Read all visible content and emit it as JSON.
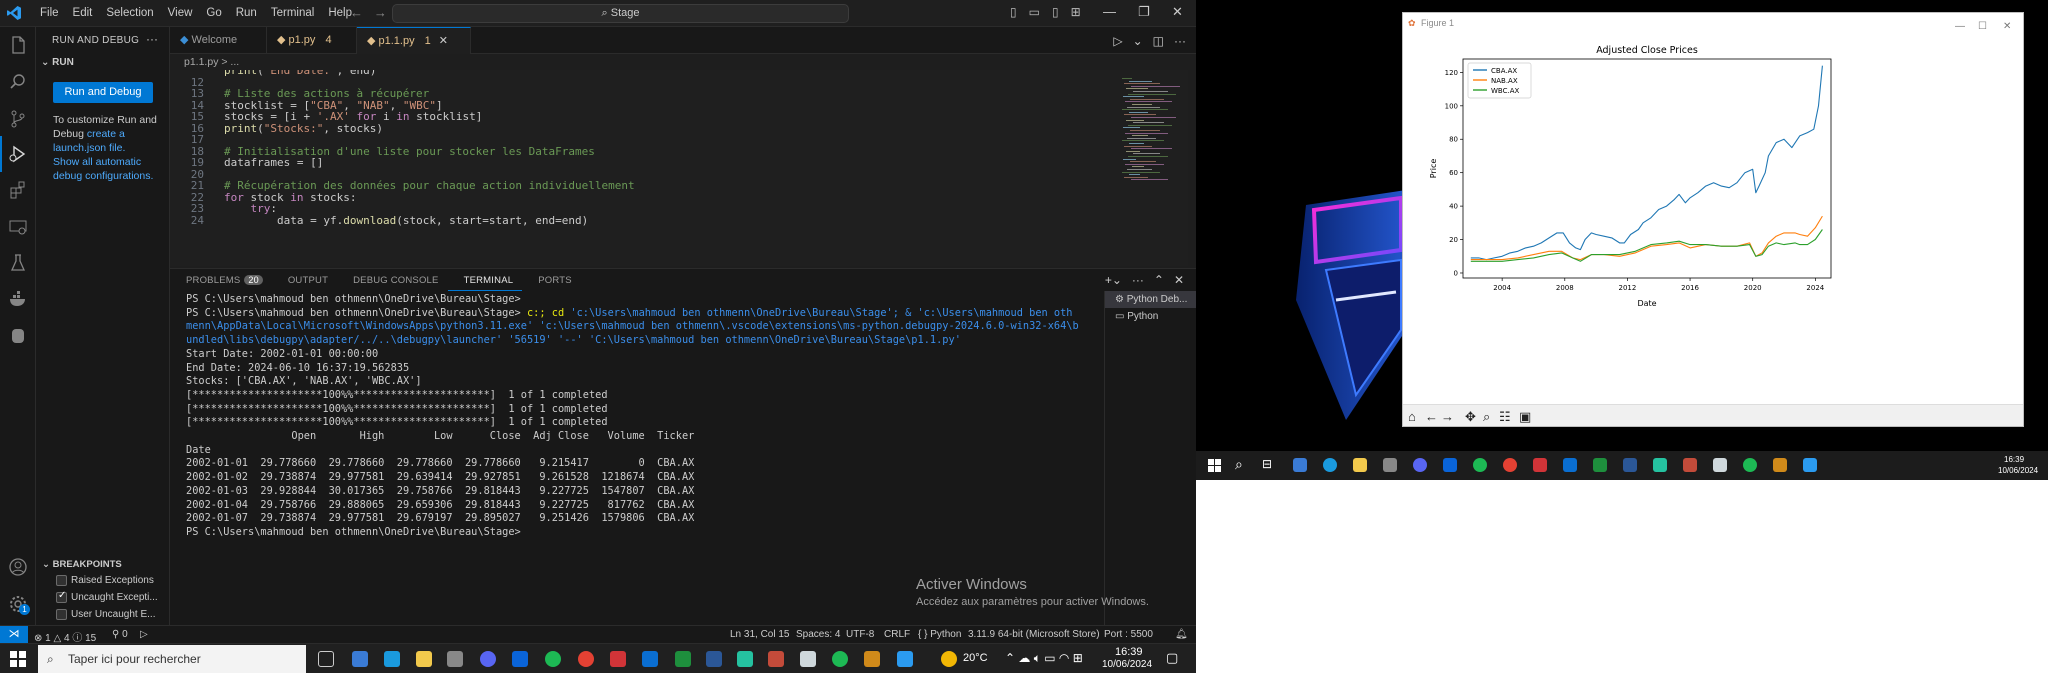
{
  "vscode": {
    "menu": [
      "File",
      "Edit",
      "Selection",
      "View",
      "Go",
      "Run",
      "Terminal",
      "Help"
    ],
    "command_center": "Stage",
    "activity_icons": [
      "explorer-icon",
      "search-icon",
      "source-control-icon",
      "run-debug-icon",
      "extensions-icon",
      "remote-explorer-icon",
      "testing-icon",
      "docker-icon",
      "toolbox-icon",
      "account-icon",
      "settings-gear-icon"
    ],
    "settings_badge": "1",
    "sidebar": {
      "header": "RUN AND DEBUG",
      "section": "RUN",
      "run_button": "Run and Debug",
      "customize_text_1": "To customize Run and Debug ",
      "customize_link": "create a launch.json file.",
      "show_all_link": "Show all automatic debug configurations.",
      "breakpoints_header": "BREAKPOINTS",
      "breakpoints": [
        {
          "label": "Raised Exceptions",
          "checked": false
        },
        {
          "label": "Uncaught Excepti...",
          "checked": true
        },
        {
          "label": "User Uncaught E...",
          "checked": false
        }
      ]
    },
    "tabs": [
      {
        "label": "Welcome",
        "badge": ""
      },
      {
        "label": "p1.py",
        "badge": "4"
      },
      {
        "label": "p1.1.py",
        "badge": "1"
      }
    ],
    "breadcrumb": "p1.1.py > ...",
    "code_lines": [
      {
        "n": "",
        "text": "print(\"End Date:\", end)"
      },
      {
        "n": "12",
        "text": ""
      },
      {
        "n": "13",
        "text": "# Liste des actions à récupérer"
      },
      {
        "n": "14",
        "text": "stocklist = [\"CBA\", \"NAB\", \"WBC\"]"
      },
      {
        "n": "15",
        "text": "stocks = [i + '.AX' for i in stocklist]"
      },
      {
        "n": "16",
        "text": "print(\"Stocks:\", stocks)"
      },
      {
        "n": "17",
        "text": ""
      },
      {
        "n": "18",
        "text": "# Initialisation d'une liste pour stocker les DataFrames"
      },
      {
        "n": "19",
        "text": "dataframes = []"
      },
      {
        "n": "20",
        "text": ""
      },
      {
        "n": "21",
        "text": "# Récupération des données pour chaque action individuellement"
      },
      {
        "n": "22",
        "text": "for stock in stocks:"
      },
      {
        "n": "23",
        "text": "    try:"
      },
      {
        "n": "24",
        "text": "        data = yf.download(stock, start=start, end=end)"
      }
    ],
    "panel_tabs": [
      "PROBLEMS",
      "OUTPUT",
      "DEBUG CONSOLE",
      "TERMINAL",
      "PORTS"
    ],
    "problems_count": "20",
    "terminal_lines": [
      "PS C:\\Users\\mahmoud ben othmenn\\OneDrive\\Bureau\\Stage>",
      "PS C:\\Users\\mahmoud ben othmenn\\OneDrive\\Bureau\\Stage> c:; cd 'c:\\Users\\mahmoud ben othmenn\\OneDrive\\Bureau\\Stage'; & 'c:\\Users\\mahmoud ben oth",
      "menn\\AppData\\Local\\Microsoft\\WindowsApps\\python3.11.exe' 'c:\\Users\\mahmoud ben othmenn\\.vscode\\extensions\\ms-python.debugpy-2024.6.0-win32-x64\\b",
      "undled\\libs\\debugpy\\adapter/../..\\debugpy\\launcher' '56519' '--' 'C:\\Users\\mahmoud ben othmenn\\OneDrive\\Bureau\\Stage\\p1.1.py'",
      "Start Date: 2002-01-01 00:00:00",
      "End Date: 2024-06-10 16:37:19.562835",
      "Stocks: ['CBA.AX', 'NAB.AX', 'WBC.AX']",
      "[*********************100%%**********************]  1 of 1 completed",
      "[*********************100%%**********************]  1 of 1 completed",
      "[*********************100%%**********************]  1 of 1 completed",
      "                 Open       High        Low      Close  Adj Close   Volume  Ticker",
      "Date",
      "2002-01-01  29.778660  29.778660  29.778660  29.778660   9.215417        0  CBA.AX",
      "2002-01-02  29.738874  29.977581  29.639414  29.927851   9.261528  1218674  CBA.AX",
      "2002-01-03  29.928844  30.017365  29.758766  29.818443   9.227725  1547807  CBA.AX",
      "2002-01-04  29.758766  29.888065  29.659306  29.818443   9.227725   817762  CBA.AX",
      "2002-01-07  29.738874  29.977581  29.679197  29.895027   9.251426  1579806  CBA.AX",
      "PS C:\\Users\\mahmoud ben othmenn\\OneDrive\\Bureau\\Stage> "
    ],
    "terminal_list": [
      "Python Deb...",
      "Python"
    ],
    "watermark_title": "Activer Windows",
    "watermark_sub": "Accédez aux paramètres pour activer Windows.",
    "status": {
      "errors": "1",
      "warnings": "4",
      "info": "15",
      "ports_fwd": "0",
      "cursor": "Ln 31, Col 15",
      "spaces": "Spaces: 4",
      "encoding": "UTF-8",
      "eol": "CRLF",
      "language": "Python",
      "interpreter": "3.11.9 64-bit (Microsoft Store)",
      "port": "Port : 5500"
    }
  },
  "taskbar_left": {
    "search_placeholder": "Taper ici pour rechercher",
    "temperature": "20°C",
    "time": "16:39",
    "date": "10/06/2024"
  },
  "taskbar_right": {
    "time": "16:39",
    "date": "10/06/2024"
  },
  "figure_window": {
    "title": "Figure 1"
  },
  "chart_data": {
    "type": "line",
    "title": "Adjusted Close Prices",
    "xlabel": "Date",
    "ylabel": "Price",
    "xlim": [
      2001.5,
      2025.0
    ],
    "ylim": [
      -3,
      128
    ],
    "xticks": [
      2004,
      2008,
      2012,
      2016,
      2020,
      2024
    ],
    "yticks": [
      0,
      20,
      40,
      60,
      80,
      100,
      120
    ],
    "legend_position": "top-left",
    "series": [
      {
        "name": "CBA.AX",
        "color": "#1f77b4",
        "x": [
          2002.0,
          2002.5,
          2003.0,
          2003.5,
          2004.0,
          2004.5,
          2005.0,
          2005.5,
          2006.0,
          2006.5,
          2007.0,
          2007.5,
          2007.9,
          2008.3,
          2008.7,
          2009.0,
          2009.3,
          2009.7,
          2010.0,
          2010.5,
          2011.0,
          2011.5,
          2011.8,
          2012.2,
          2012.7,
          2013.0,
          2013.5,
          2014.0,
          2014.5,
          2015.0,
          2015.3,
          2015.7,
          2016.0,
          2016.5,
          2017.0,
          2017.5,
          2018.0,
          2018.5,
          2019.0,
          2019.5,
          2020.0,
          2020.2,
          2020.4,
          2020.8,
          2021.0,
          2021.5,
          2022.0,
          2022.5,
          2023.0,
          2023.5,
          2023.9,
          2024.2,
          2024.45
        ],
        "y": [
          9,
          9,
          8,
          9,
          10,
          12,
          13,
          15,
          16,
          18,
          21,
          24,
          24,
          18,
          15,
          14,
          20,
          24,
          23,
          22,
          21,
          18,
          18,
          23,
          26,
          30,
          33,
          38,
          40,
          44,
          47,
          42,
          45,
          48,
          52,
          54,
          52,
          51,
          54,
          60,
          62,
          48,
          52,
          60,
          70,
          78,
          80,
          75,
          82,
          84,
          86,
          100,
          124
        ]
      },
      {
        "name": "NAB.AX",
        "color": "#ff7f0e",
        "x": [
          2002.0,
          2003.0,
          2004.0,
          2005.0,
          2006.0,
          2007.0,
          2007.8,
          2008.5,
          2009.0,
          2009.7,
          2010.5,
          2011.5,
          2012.5,
          2013.5,
          2014.5,
          2015.3,
          2016.0,
          2017.0,
          2018.0,
          2019.0,
          2019.8,
          2020.2,
          2020.6,
          2021.0,
          2021.5,
          2022.0,
          2022.7,
          2023.0,
          2023.5,
          2024.0,
          2024.45
        ],
        "y": [
          8,
          8,
          8,
          9,
          11,
          13,
          13,
          9,
          8,
          11,
          11,
          10,
          12,
          16,
          17,
          18,
          15,
          17,
          16,
          16,
          18,
          10,
          12,
          18,
          22,
          24,
          24,
          23,
          22,
          27,
          34
        ]
      },
      {
        "name": "WBC.AX",
        "color": "#2ca02c",
        "x": [
          2002.0,
          2003.0,
          2004.0,
          2005.0,
          2006.0,
          2007.0,
          2007.8,
          2008.5,
          2009.0,
          2009.7,
          2010.5,
          2011.5,
          2012.5,
          2013.5,
          2014.5,
          2015.3,
          2016.0,
          2017.0,
          2018.0,
          2019.0,
          2019.8,
          2020.2,
          2020.6,
          2021.0,
          2021.5,
          2022.0,
          2022.7,
          2023.0,
          2023.5,
          2024.0,
          2024.45
        ],
        "y": [
          7,
          7,
          7,
          8,
          9,
          11,
          12,
          9,
          7,
          11,
          11,
          11,
          13,
          17,
          18,
          19,
          17,
          17,
          16,
          16,
          17,
          10,
          11,
          16,
          18,
          17,
          18,
          17,
          17,
          20,
          26
        ]
      }
    ]
  }
}
